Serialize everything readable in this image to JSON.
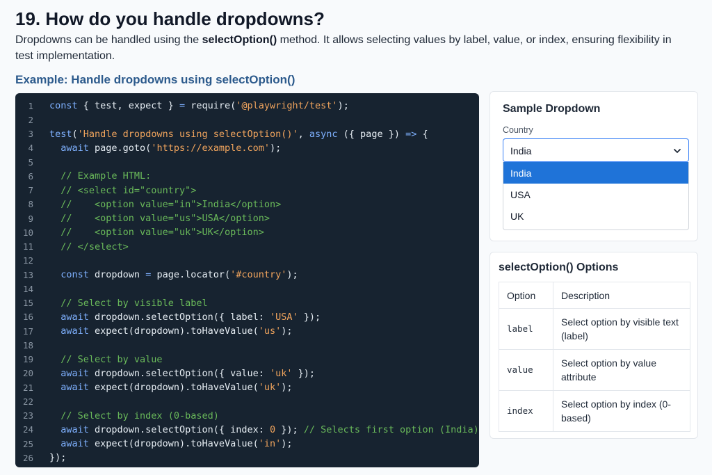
{
  "page": {
    "title": "19. How do you handle dropdowns?",
    "intro_before": "Dropdowns can be handled using the ",
    "intro_bold": "selectOption()",
    "intro_after": " method. It allows selecting values by label, value, or index, ensuring flexibility in test implementation.",
    "example_heading": "Example: Handle dropdowns using selectOption()"
  },
  "code": {
    "lines": [
      {
        "n": "1",
        "tokens": [
          [
            "kw",
            "const"
          ],
          [
            "pl",
            " { test, expect } "
          ],
          [
            "kw",
            "="
          ],
          [
            "pl",
            " require("
          ],
          [
            "str",
            "'@playwright/test'"
          ],
          [
            "pl",
            ");"
          ]
        ]
      },
      {
        "n": "2",
        "tokens": []
      },
      {
        "n": "3",
        "tokens": [
          [
            "fn",
            "test"
          ],
          [
            "pl",
            "("
          ],
          [
            "str",
            "'Handle dropdowns using selectOption()'"
          ],
          [
            "pl",
            ", "
          ],
          [
            "kw",
            "async"
          ],
          [
            "pl",
            " ({ page }) "
          ],
          [
            "kw",
            "=>"
          ],
          [
            "pl",
            " {"
          ]
        ]
      },
      {
        "n": "4",
        "tokens": [
          [
            "pl",
            "  "
          ],
          [
            "kw",
            "await"
          ],
          [
            "pl",
            " page.goto("
          ],
          [
            "str",
            "'https://example.com'"
          ],
          [
            "pl",
            ");"
          ]
        ]
      },
      {
        "n": "5",
        "tokens": []
      },
      {
        "n": "6",
        "tokens": [
          [
            "pl",
            "  "
          ],
          [
            "cm",
            "// Example HTML:"
          ]
        ]
      },
      {
        "n": "7",
        "tokens": [
          [
            "pl",
            "  "
          ],
          [
            "cm",
            "// <select id=\"country\">"
          ]
        ]
      },
      {
        "n": "8",
        "tokens": [
          [
            "pl",
            "  "
          ],
          [
            "cm",
            "//    <option value=\"in\">India</option>"
          ]
        ]
      },
      {
        "n": "9",
        "tokens": [
          [
            "pl",
            "  "
          ],
          [
            "cm",
            "//    <option value=\"us\">USA</option>"
          ]
        ]
      },
      {
        "n": "10",
        "tokens": [
          [
            "pl",
            "  "
          ],
          [
            "cm",
            "//    <option value=\"uk\">UK</option>"
          ]
        ]
      },
      {
        "n": "11",
        "tokens": [
          [
            "pl",
            "  "
          ],
          [
            "cm",
            "// </select>"
          ]
        ]
      },
      {
        "n": "12",
        "tokens": []
      },
      {
        "n": "13",
        "tokens": [
          [
            "pl",
            "  "
          ],
          [
            "kw",
            "const"
          ],
          [
            "pl",
            " dropdown "
          ],
          [
            "kw",
            "="
          ],
          [
            "pl",
            " page.locator("
          ],
          [
            "str",
            "'#country'"
          ],
          [
            "pl",
            ");"
          ]
        ]
      },
      {
        "n": "14",
        "tokens": []
      },
      {
        "n": "15",
        "tokens": [
          [
            "pl",
            "  "
          ],
          [
            "cm",
            "// Select by visible label"
          ]
        ]
      },
      {
        "n": "16",
        "tokens": [
          [
            "pl",
            "  "
          ],
          [
            "kw",
            "await"
          ],
          [
            "pl",
            " dropdown.selectOption({ label: "
          ],
          [
            "str",
            "'USA'"
          ],
          [
            "pl",
            " });"
          ]
        ]
      },
      {
        "n": "17",
        "tokens": [
          [
            "pl",
            "  "
          ],
          [
            "kw",
            "await"
          ],
          [
            "pl",
            " expect(dropdown).toHaveValue("
          ],
          [
            "str",
            "'us'"
          ],
          [
            "pl",
            ");"
          ]
        ]
      },
      {
        "n": "18",
        "tokens": []
      },
      {
        "n": "19",
        "tokens": [
          [
            "pl",
            "  "
          ],
          [
            "cm",
            "// Select by value"
          ]
        ]
      },
      {
        "n": "20",
        "tokens": [
          [
            "pl",
            "  "
          ],
          [
            "kw",
            "await"
          ],
          [
            "pl",
            " dropdown.selectOption({ value: "
          ],
          [
            "str",
            "'uk'"
          ],
          [
            "pl",
            " });"
          ]
        ]
      },
      {
        "n": "21",
        "tokens": [
          [
            "pl",
            "  "
          ],
          [
            "kw",
            "await"
          ],
          [
            "pl",
            " expect(dropdown).toHaveValue("
          ],
          [
            "str",
            "'uk'"
          ],
          [
            "pl",
            ");"
          ]
        ]
      },
      {
        "n": "22",
        "tokens": []
      },
      {
        "n": "23",
        "tokens": [
          [
            "pl",
            "  "
          ],
          [
            "cm",
            "// Select by index (0-based)"
          ]
        ]
      },
      {
        "n": "24",
        "tokens": [
          [
            "pl",
            "  "
          ],
          [
            "kw",
            "await"
          ],
          [
            "pl",
            " dropdown.selectOption({ index: "
          ],
          [
            "str",
            "0"
          ],
          [
            "pl",
            " }); "
          ],
          [
            "cm",
            "// Selects first option (India)"
          ]
        ]
      },
      {
        "n": "25",
        "tokens": [
          [
            "pl",
            "  "
          ],
          [
            "kw",
            "await"
          ],
          [
            "pl",
            " expect(dropdown).toHaveValue("
          ],
          [
            "str",
            "'in'"
          ],
          [
            "pl",
            ");"
          ]
        ]
      },
      {
        "n": "26",
        "tokens": [
          [
            "pl",
            "});"
          ]
        ]
      }
    ]
  },
  "sample_dropdown": {
    "title": "Sample Dropdown",
    "field_label": "Country",
    "selected_value": "India",
    "chevron_icon": "chevron-down-icon",
    "options": [
      "India",
      "USA",
      "UK"
    ],
    "highlighted_index": 0
  },
  "options_table": {
    "title": "selectOption() Options",
    "headers": [
      "Option",
      "Description"
    ],
    "rows": [
      {
        "option": "label",
        "description": "Select option by visible text (label)"
      },
      {
        "option": "value",
        "description": "Select option by value attribute"
      },
      {
        "option": "index",
        "description": "Select option by index (0-based)"
      }
    ]
  },
  "colors": {
    "code_background": "#172330",
    "keyword": "#7fb1ff",
    "string": "#f0a45d",
    "comment": "#6aba5a",
    "heading_accent": "#2c5a8c",
    "selected_option": "#1f73d8",
    "select_border": "#3b82f6"
  }
}
